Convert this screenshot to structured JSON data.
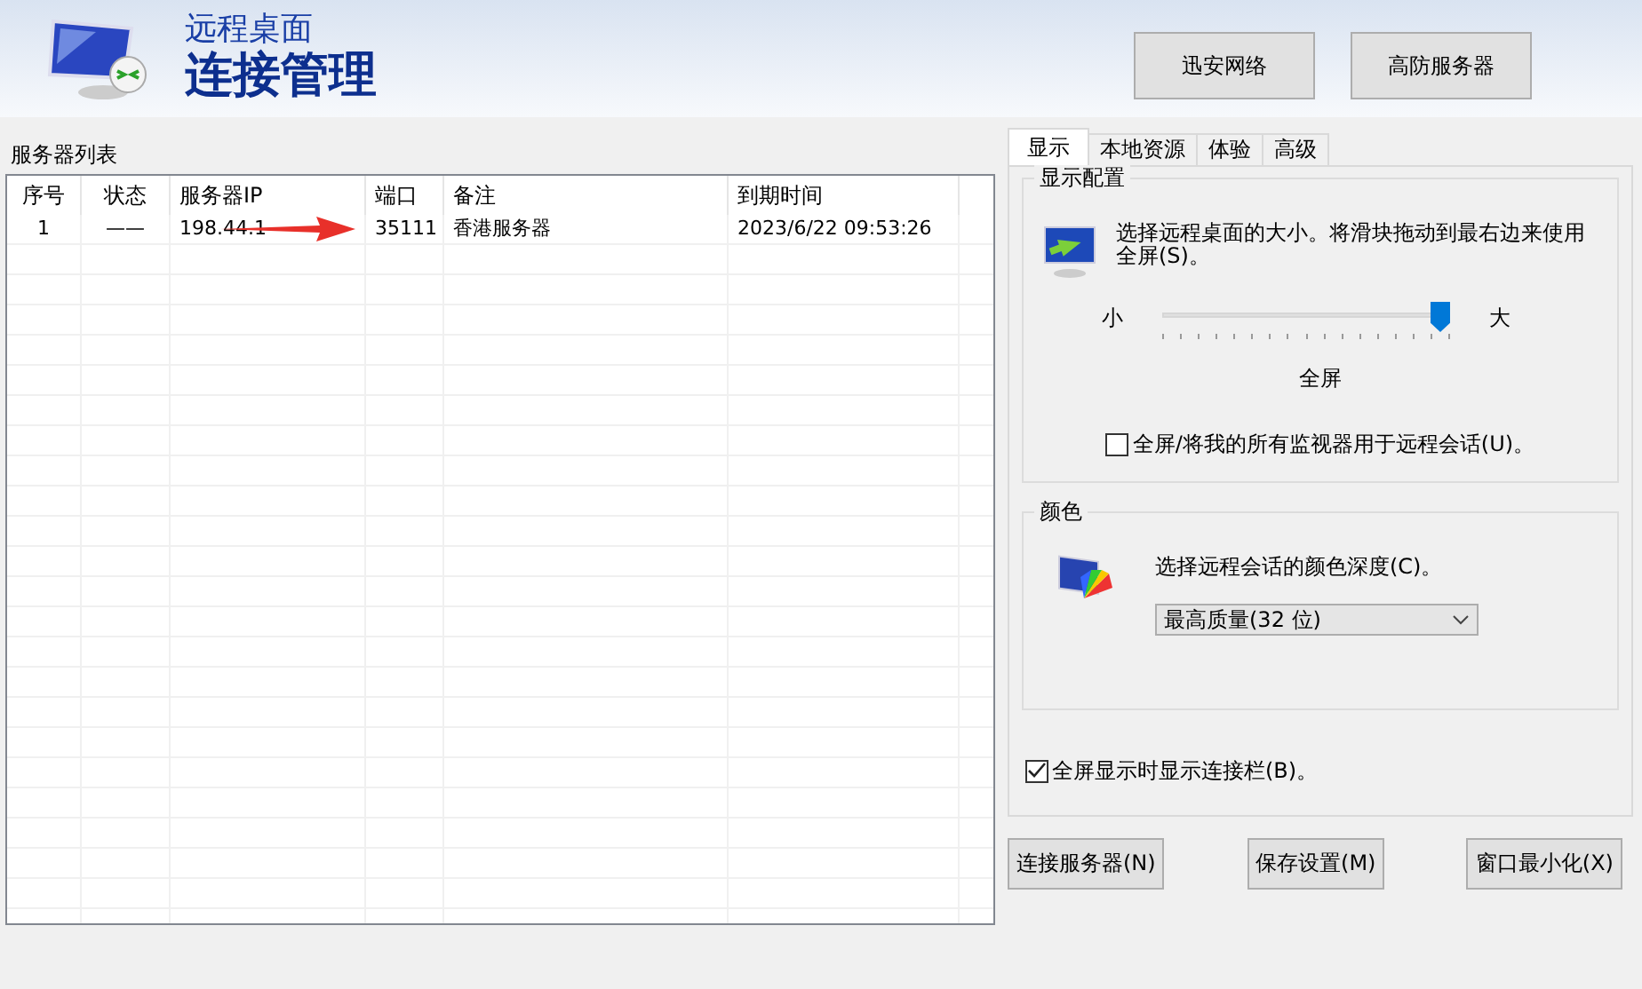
{
  "header": {
    "subtitle": "远程桌面",
    "title": "连接管理",
    "buttons": [
      "迅安网络",
      "高防服务器"
    ]
  },
  "server_list": {
    "label": "服务器列表",
    "columns": [
      "序号",
      "状态",
      "服务器IP",
      "端口",
      "备注",
      "到期时间"
    ],
    "rows": [
      {
        "cells": [
          "1",
          "——",
          "198.44.1",
          "35111",
          "香港服务器",
          "2023/6/22 09:53:26"
        ]
      }
    ]
  },
  "tabs": [
    {
      "label": "显示",
      "selected": true
    },
    {
      "label": "本地资源",
      "selected": false
    },
    {
      "label": "体验",
      "selected": false
    },
    {
      "label": "高级",
      "selected": false
    }
  ],
  "display": {
    "label": "显示配置",
    "description": "选择远程桌面的大小。将滑块拖动到最右边来使用全屏(S)。",
    "min_label": "小",
    "max_label": "大",
    "level": 1,
    "reading": "全屏",
    "all_monitors": {
      "label": "全屏/将我的所有监视器用于远程会话(U)。",
      "checked": false
    }
  },
  "color": {
    "label": "颜色",
    "description": "选择远程会话的颜色深度(C)。",
    "value": "最高质量(32 位)"
  },
  "connection_bar": {
    "label": "全屏显示时显示连接栏(B)。",
    "checked": true
  },
  "buttons": [
    "连接服务器(N)",
    "保存设置(M)",
    "窗口最小化(X)"
  ]
}
